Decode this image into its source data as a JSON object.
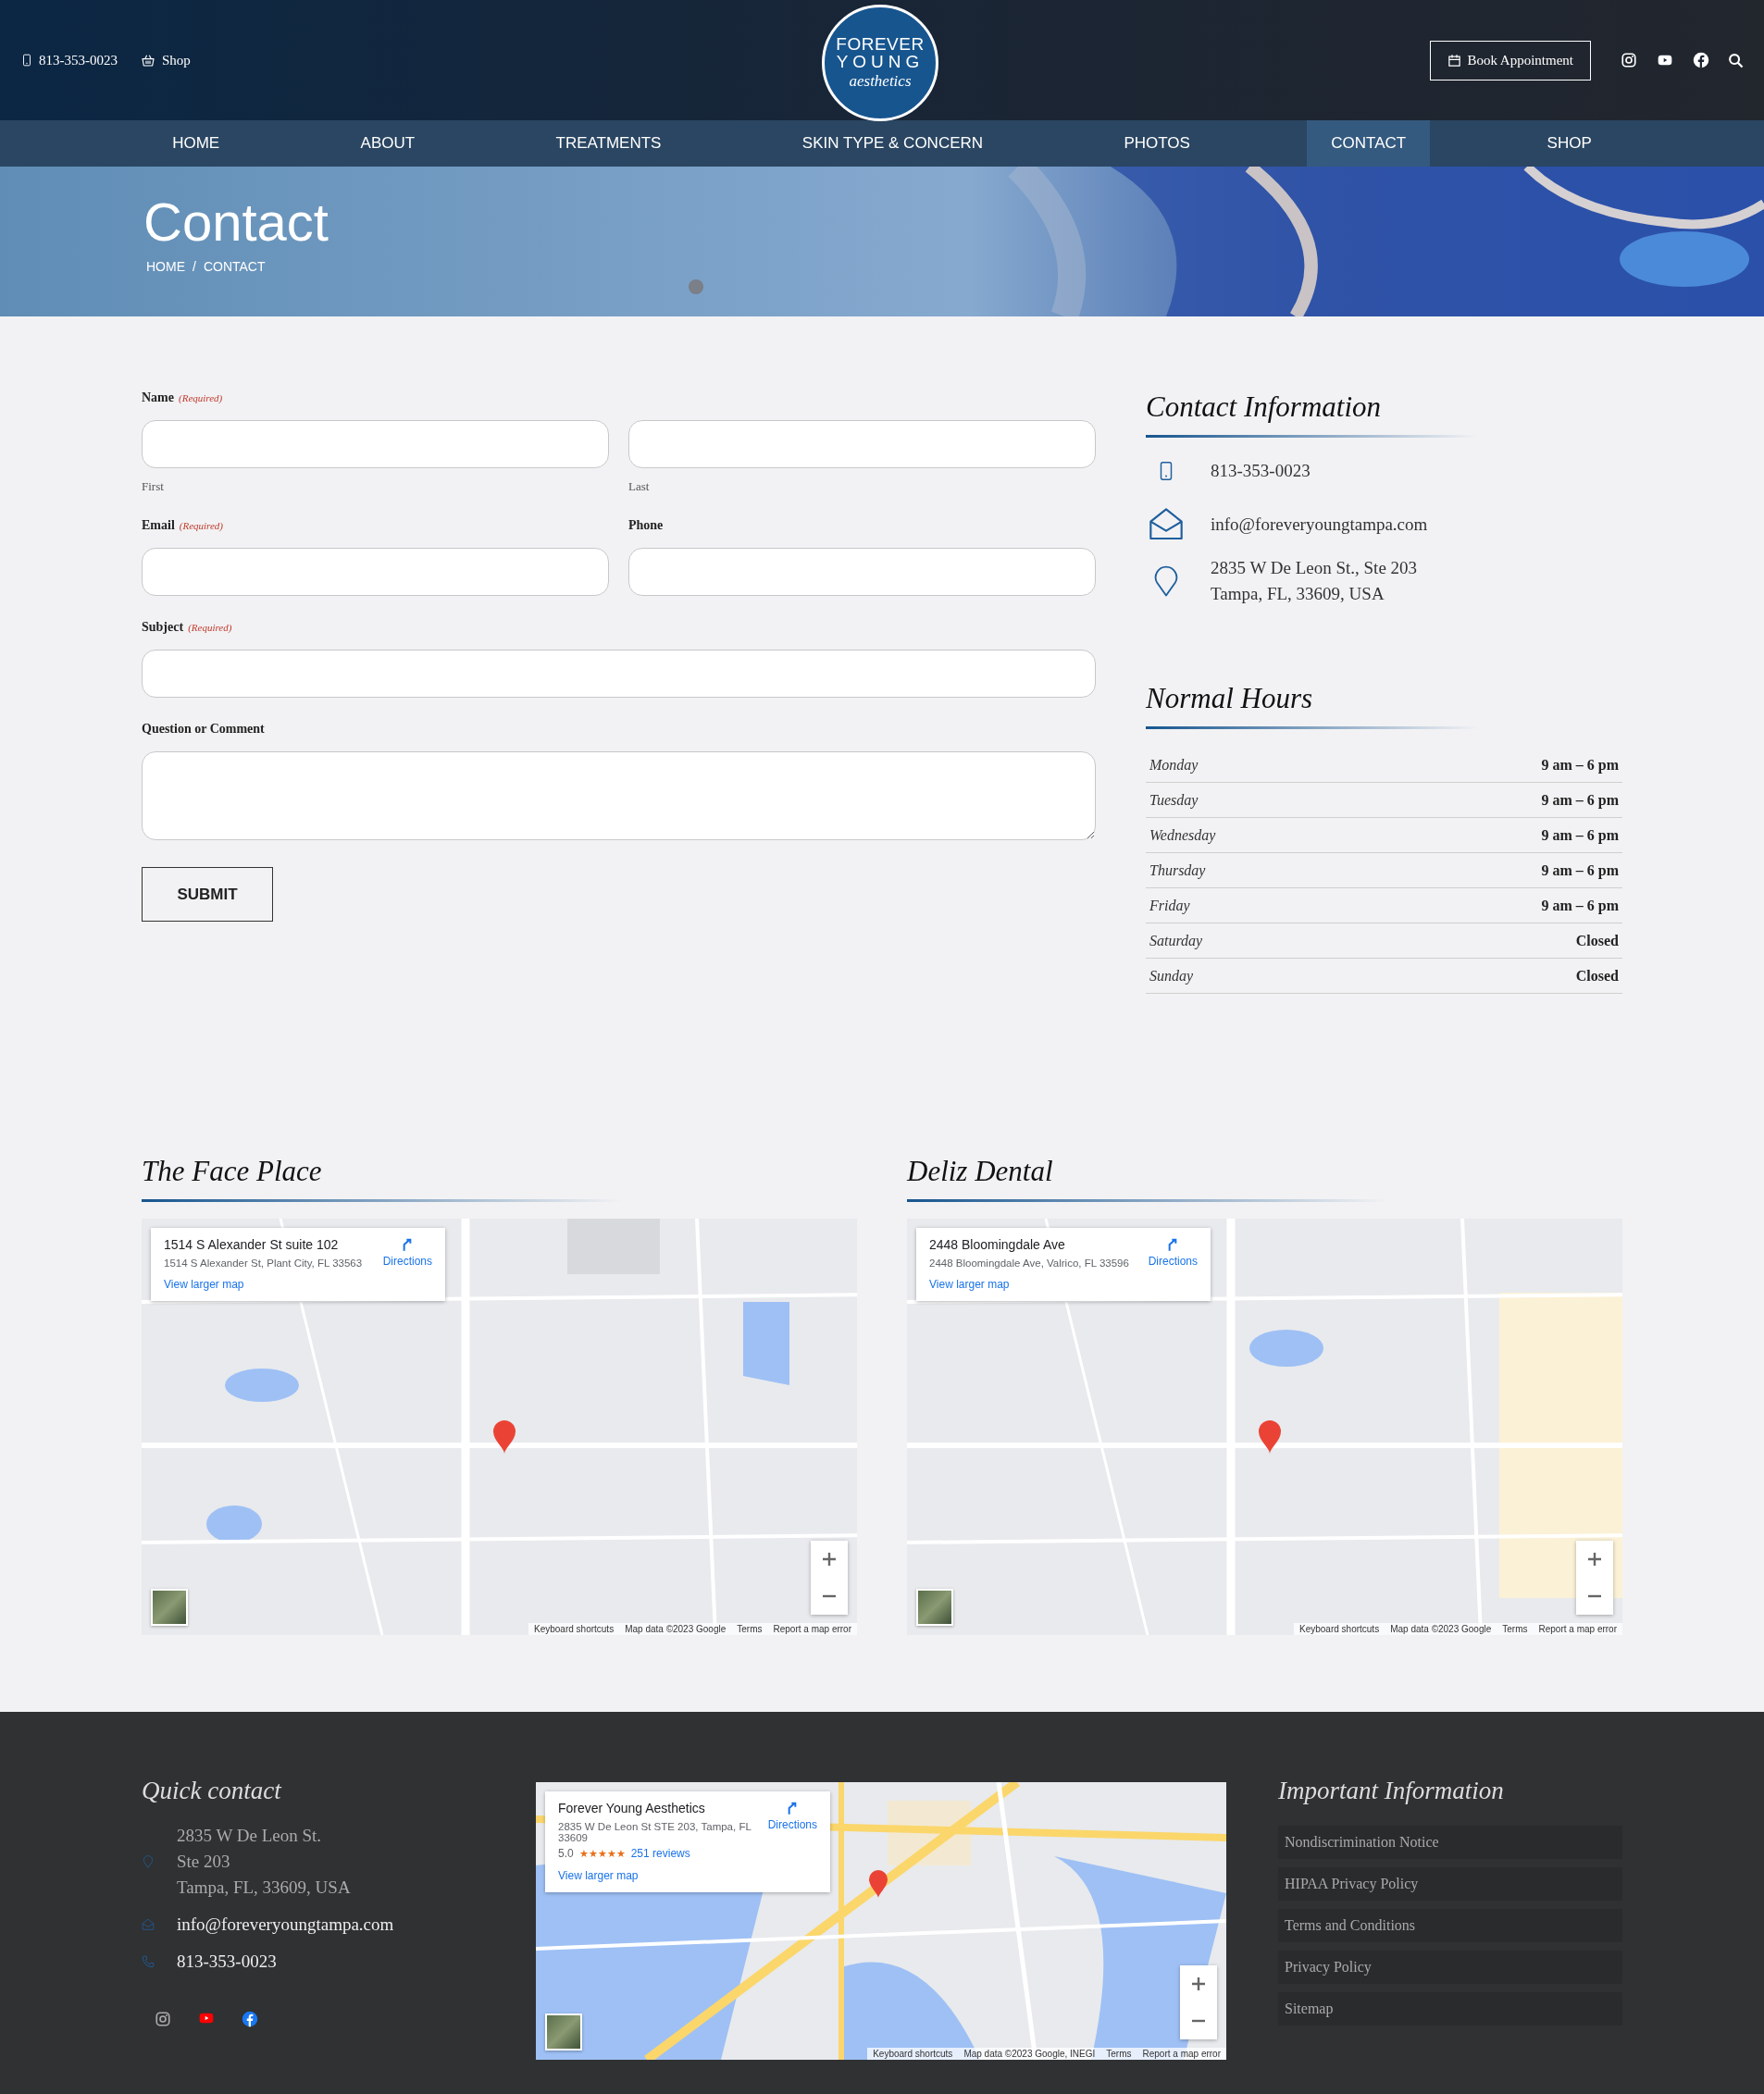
{
  "header": {
    "phone": "813-353-0023",
    "shop": "Shop",
    "logo": {
      "line1": "FOREVER",
      "line2": "YOUNG",
      "line3": "aesthetics"
    },
    "book_button": "Book Appointment"
  },
  "nav": [
    {
      "label": "HOME",
      "selected": false
    },
    {
      "label": "ABOUT",
      "selected": false
    },
    {
      "label": "TREATMENTS",
      "selected": false
    },
    {
      "label": "SKIN TYPE & CONCERN",
      "selected": false
    },
    {
      "label": "PHOTOS",
      "selected": false
    },
    {
      "label": "CONTACT",
      "selected": true
    },
    {
      "label": "SHOP",
      "selected": false
    }
  ],
  "hero": {
    "title": "Contact",
    "breadcrumb": [
      "HOME",
      "CONTACT"
    ],
    "separator": "/"
  },
  "form": {
    "fields": [
      {
        "label": "Name",
        "required": "(Required)",
        "kind": "name",
        "sublabels": [
          "First",
          "Last"
        ]
      },
      {
        "label": "Email",
        "required": "(Required)",
        "kind": "half"
      },
      {
        "label": "Phone",
        "kind": "half"
      },
      {
        "label": "Subject",
        "required": "(Required)",
        "kind": "full"
      },
      {
        "label": "Question or Comment",
        "kind": "textarea"
      }
    ],
    "submit": "SUBMIT"
  },
  "contact_info": {
    "title": "Contact Information",
    "items": [
      {
        "kind": "phone",
        "lines": [
          "813-353-0023"
        ]
      },
      {
        "kind": "email",
        "lines": [
          "info@foreveryoungtampa.com"
        ]
      },
      {
        "kind": "address",
        "lines": [
          "2835 W De Leon St., Ste 203",
          "Tampa, FL, 33609, USA"
        ]
      }
    ]
  },
  "hours": {
    "title": "Normal Hours",
    "rows": [
      {
        "day": "Monday",
        "time": "9 am – 6 pm"
      },
      {
        "day": "Tuesday",
        "time": "9 am – 6 pm"
      },
      {
        "day": "Wednesday",
        "time": "9 am – 6 pm"
      },
      {
        "day": "Thursday",
        "time": "9 am – 6 pm"
      },
      {
        "day": "Friday",
        "time": "9 am – 6 pm"
      },
      {
        "day": "Saturday",
        "time": "Closed"
      },
      {
        "day": "Sunday",
        "time": "Closed"
      }
    ]
  },
  "maps": [
    {
      "title": "The Face Place",
      "card": {
        "title": "1514 S Alexander St suite 102",
        "address": "1514 S Alexander St, Plant City, FL 33563",
        "directions": "Directions",
        "link": "View larger map"
      },
      "attribution": [
        "Keyboard shortcuts",
        "Map data ©2023 Google",
        "Terms",
        "Report a map error"
      ]
    },
    {
      "title": "Deliz Dental",
      "card": {
        "title": "2448 Bloomingdale Ave",
        "address": "2448 Bloomingdale Ave, Valrico, FL 33596",
        "directions": "Directions",
        "link": "View larger map"
      },
      "attribution": [
        "Keyboard shortcuts",
        "Map data ©2023 Google",
        "Terms",
        "Report a map error"
      ]
    }
  ],
  "footer": {
    "quick_contact": {
      "title": "Quick contact",
      "address": [
        "2835 W De Leon St.",
        "Ste 203",
        "Tampa, FL, 33609, USA"
      ],
      "email": "info@foreveryoungtampa.com",
      "phone": "813-353-0023"
    },
    "map": {
      "card": {
        "title": "Forever Young Aesthetics",
        "address": "2835 W De Leon St STE 203, Tampa, FL 33609",
        "rating": "5.0",
        "stars": 5,
        "reviews": "251 reviews",
        "directions": "Directions",
        "link": "View larger map"
      },
      "attribution": [
        "Keyboard shortcuts",
        "Map data ©2023 Google, INEGI",
        "Terms",
        "Report a map error"
      ]
    },
    "important": {
      "title": "Important Information",
      "links": [
        "Nondiscrimination Notice",
        "HIPAA Privacy Policy",
        "Terms and Conditions",
        "Privacy Policy",
        "Sitemap"
      ]
    }
  }
}
